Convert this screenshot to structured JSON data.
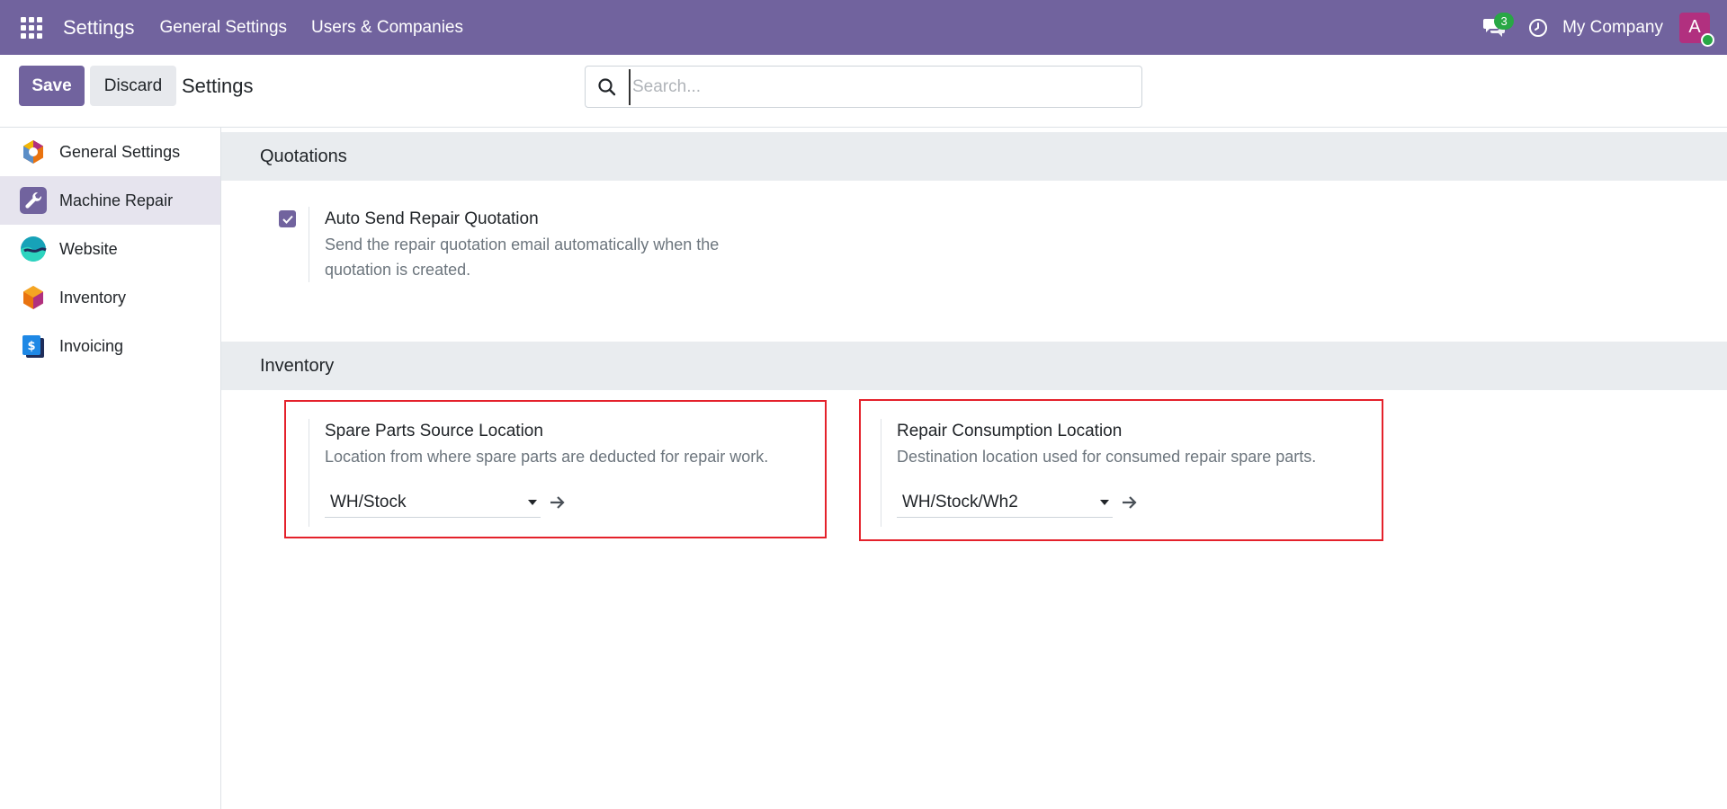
{
  "navbar": {
    "brand": "Settings",
    "links": [
      "General Settings",
      "Users & Companies"
    ],
    "chat_count": "3",
    "company": "My Company",
    "avatar_letter": "A",
    "bg_color": "#71639e"
  },
  "control_panel": {
    "save_label": "Save",
    "discard_label": "Discard",
    "title": "Settings",
    "search_placeholder": "Search..."
  },
  "sidebar": {
    "items": [
      {
        "label": "General Settings",
        "icon": "odoo-hexagon-icon"
      },
      {
        "label": "Machine Repair",
        "icon": "wrench-icon",
        "active": true
      },
      {
        "label": "Website",
        "icon": "website-icon"
      },
      {
        "label": "Inventory",
        "icon": "inventory-icon"
      },
      {
        "label": "Invoicing",
        "icon": "invoicing-icon"
      }
    ]
  },
  "sections": {
    "quotations": {
      "title": "Quotations",
      "auto_send": {
        "title": "Auto Send Repair Quotation",
        "desc_line1": "Send the repair quotation email automatically when the",
        "desc_line2": "quotation is created.",
        "checked": true
      }
    },
    "inventory": {
      "title": "Inventory",
      "spare_parts": {
        "title": "Spare Parts Source Location",
        "desc": "Location from where spare parts are deducted for repair work.",
        "value": "WH/Stock"
      },
      "consumption": {
        "title": "Repair Consumption Location",
        "desc": "Destination location used for consumed repair spare parts.",
        "value": "WH/Stock/Wh2"
      }
    }
  },
  "colors": {
    "accent": "#71639e",
    "highlight": "#e4212b",
    "badge": "#28a745",
    "avatar": "#b1307f"
  }
}
